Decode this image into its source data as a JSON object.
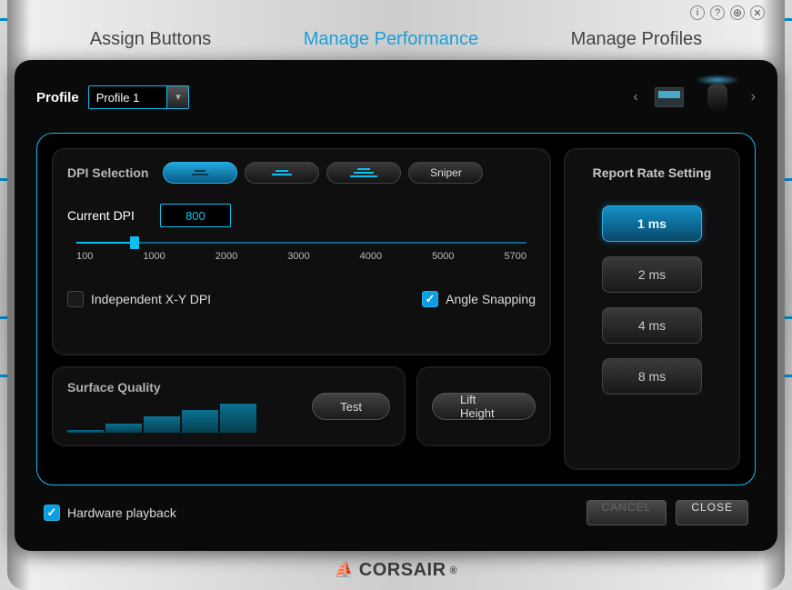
{
  "titleIcons": [
    "i",
    "?",
    "⊕",
    "✕"
  ],
  "tabs": {
    "assign": "Assign Buttons",
    "performance": "Manage Performance",
    "profiles": "Manage Profiles"
  },
  "profile": {
    "label": "Profile",
    "selected": "Profile 1"
  },
  "dpi": {
    "title": "DPI Selection",
    "sniper": "Sniper",
    "currentLabel": "Current DPI",
    "currentValue": "800",
    "ticks": [
      "100",
      "1000",
      "2000",
      "3000",
      "4000",
      "5000",
      "5700"
    ],
    "handlePct": 13,
    "independentLabel": "Independent X-Y DPI",
    "independentChecked": false,
    "angleLabel": "Angle Snapping",
    "angleChecked": true
  },
  "surface": {
    "title": "Surface Quality",
    "test": "Test"
  },
  "lift": {
    "label": "Lift Height"
  },
  "rate": {
    "title": "Report Rate Setting",
    "options": [
      "1 ms",
      "2 ms",
      "4 ms",
      "8 ms"
    ],
    "selected": "1 ms"
  },
  "hwPlayback": {
    "label": "Hardware playback",
    "checked": true
  },
  "footer": {
    "cancel": "CANCEL",
    "close": "CLOSE"
  },
  "brand": "CORSAIR"
}
